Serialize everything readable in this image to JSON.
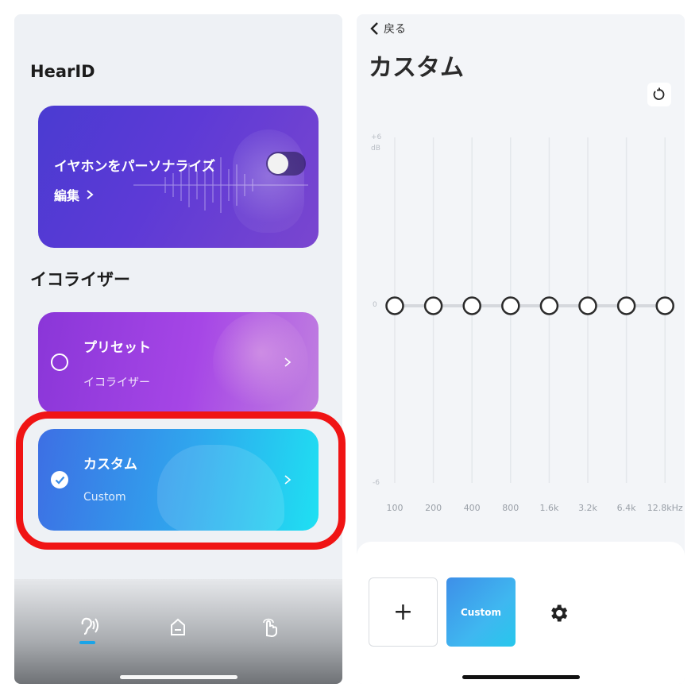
{
  "left": {
    "hearid_title": "HearID",
    "personalize": {
      "label": "イヤホンをパーソナライズ",
      "toggle_on": true,
      "edit_label": "編集"
    },
    "equalizer_title": "イコライザー",
    "preset": {
      "title": "プリセット",
      "subtitle": "イコライザー",
      "selected": false
    },
    "custom": {
      "title": "カスタム",
      "subtitle": "Custom",
      "selected": true
    },
    "nav": {
      "items": [
        {
          "icon": "ear-icon",
          "active": true
        },
        {
          "icon": "home-icon",
          "active": false
        },
        {
          "icon": "touch-gesture-icon",
          "active": false
        }
      ]
    }
  },
  "right": {
    "back_label": "戻る",
    "title": "カスタム",
    "eq": {
      "y_top_label": "+6",
      "y_unit_label": "dB",
      "y_zero_label": "0",
      "y_bottom_label": "-6",
      "bands": [
        "100",
        "200",
        "400",
        "800",
        "1.6k",
        "3.2k",
        "6.4k",
        "12.8kHz"
      ],
      "gains_db": [
        0,
        0,
        0,
        0,
        0,
        0,
        0,
        0
      ]
    },
    "add_label": "+",
    "custom_tile_label": "Custom"
  },
  "colors": {
    "highlight": "#f01414",
    "arrow": "#f01414",
    "nav_active": "#1aa4e8"
  }
}
